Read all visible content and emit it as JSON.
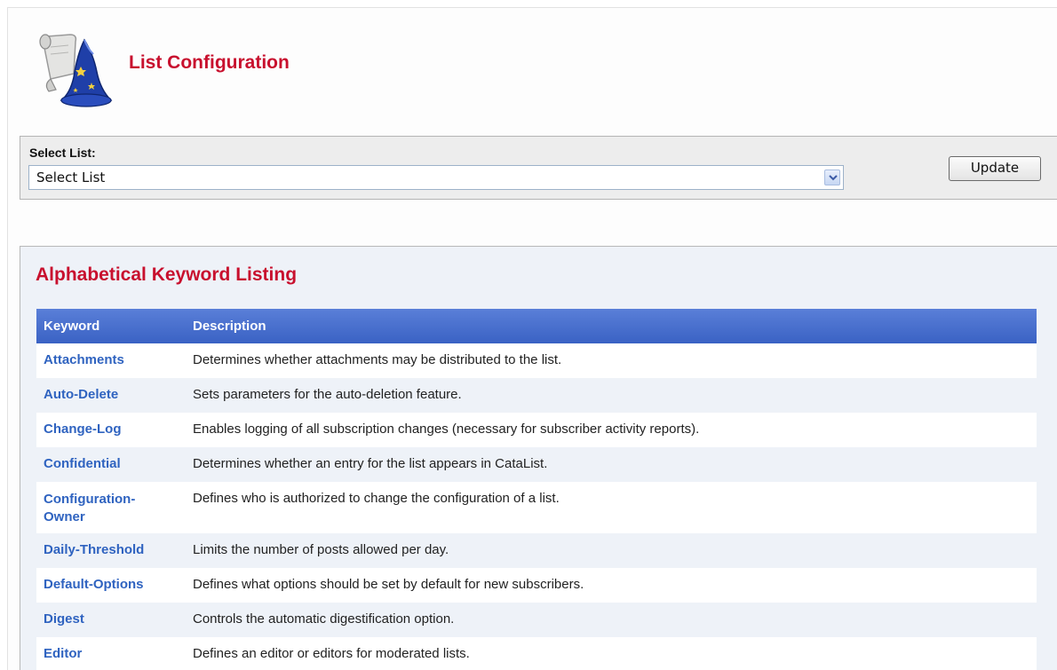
{
  "header": {
    "title": "List Configuration",
    "logo_icon": "wizard-hat-scroll-icon"
  },
  "select_panel": {
    "label": "Select List:",
    "selected_value": "Select List",
    "update_label": "Update"
  },
  "keywords": {
    "title": "Alphabetical Keyword Listing",
    "columns": [
      "Keyword",
      "Description"
    ],
    "rows": [
      {
        "keyword": "Attachments",
        "description": "Determines whether attachments may be distributed to the list."
      },
      {
        "keyword": "Auto-Delete",
        "description": "Sets parameters for the auto-deletion feature."
      },
      {
        "keyword": "Change-Log",
        "description": "Enables logging of all subscription changes (necessary for subscriber activity reports)."
      },
      {
        "keyword": "Confidential",
        "description": "Determines whether an entry for the list appears in CataList."
      },
      {
        "keyword_line1": "Configuration-",
        "keyword_line2": "Owner",
        "description": "Defines who is authorized to change the configuration of a list."
      },
      {
        "keyword": "Daily-Threshold",
        "description": "Limits the number of posts allowed per day."
      },
      {
        "keyword": "Default-Options",
        "description": "Defines what options should be set by default for new subscribers."
      },
      {
        "keyword": "Digest",
        "description": "Controls the automatic digestification option."
      },
      {
        "keyword": "Editor",
        "description": "Defines an editor or editors for moderated lists."
      }
    ]
  },
  "colors": {
    "title_red": "#c8102e",
    "link_blue": "#2f63c0",
    "header_blue": "#3a62c4"
  }
}
